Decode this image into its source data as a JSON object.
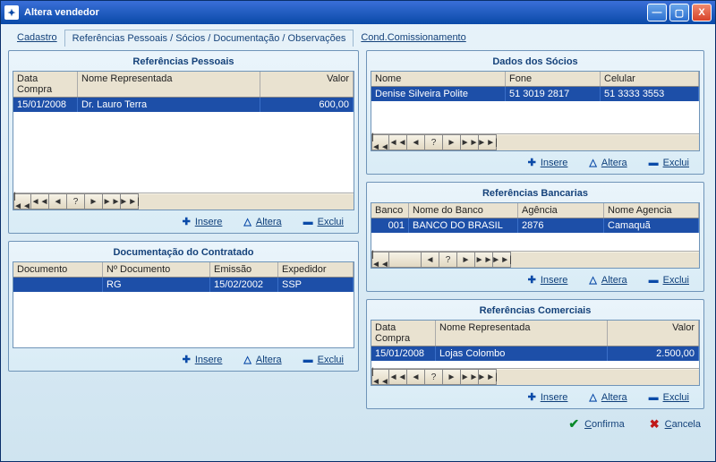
{
  "window": {
    "title": "Altera vendedor"
  },
  "tabs": {
    "cadastro": "Cadastro",
    "referencias": "Referências Pessoais / Sócios / Documentação / Observações",
    "comiss": "Cond.Comissionamento"
  },
  "navGlyphs": {
    "first": "|◄◄",
    "prevpg": "◄◄",
    "prev": "◄",
    "query": "?",
    "next": "►",
    "nextpg": "►►",
    "last": "►►|"
  },
  "actions": {
    "insere": "Insere",
    "altera": "Altera",
    "exclui": "Exclui"
  },
  "footer": {
    "confirma": "Confirma",
    "cancela": "Cancela"
  },
  "panels": {
    "refPessoais": {
      "title": "Referências Pessoais",
      "cols": {
        "data": "Data Compra",
        "nome": "Nome Representada",
        "valor": "Valor"
      },
      "row": {
        "data": "15/01/2008",
        "nome": "Dr. Lauro Terra",
        "valor": "600,00"
      }
    },
    "docContratado": {
      "title": "Documentação do Contratado",
      "cols": {
        "doc": "Documento",
        "num": "Nº Documento",
        "emi": "Emissão",
        "exp": "Expedidor"
      },
      "row": {
        "doc": "",
        "num": "RG",
        "emi": "15/02/2002",
        "exp": "SSP"
      }
    },
    "socios": {
      "title": "Dados dos Sócios",
      "cols": {
        "nome": "Nome",
        "fone": "Fone",
        "cel": "Celular"
      },
      "row": {
        "nome": "Denise Silveira Polite",
        "fone": "51 3019 2817",
        "cel": "51 3333 3553"
      }
    },
    "bancarias": {
      "title": "Referências Bancarias",
      "cols": {
        "banco": "Banco",
        "nome": "Nome do Banco",
        "ag": "Agência",
        "nag": "Nome Agencia"
      },
      "row": {
        "banco": "001",
        "nome": "BANCO DO BRASIL",
        "ag": "2876",
        "nag": "Camaquã"
      }
    },
    "comerciais": {
      "title": "Referências Comerciais",
      "cols": {
        "data": "Data Compra",
        "nome": "Nome Representada",
        "valor": "Valor"
      },
      "row": {
        "data": "15/01/2008",
        "nome": "Lojas Colombo",
        "valor": "2.500,00"
      }
    }
  }
}
